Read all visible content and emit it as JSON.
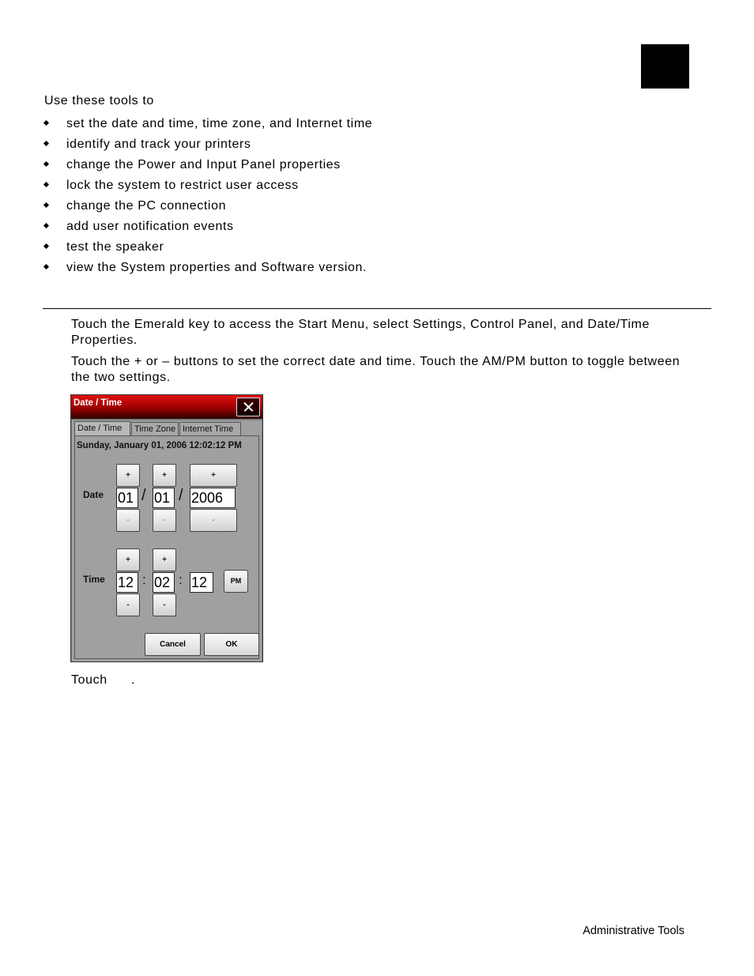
{
  "intro": "Use these tools to",
  "bullets": [
    "set the date and time, time zone, and Internet time",
    "identify and track your printers",
    "change the Power and Input Panel properties",
    "lock the system to restrict user access",
    "change the PC connection",
    "add user notification events",
    "test the speaker",
    "view the System properties and Software version."
  ],
  "steps": [
    "Touch the Emerald key to access the Start Menu, select Settings, Control Panel, and Date/Time Properties.",
    "Touch the + or – buttons to set the correct date and time.  Touch the AM/PM button to toggle between the two settings.",
    "Touch      ."
  ],
  "dialog": {
    "title": "Date / Time",
    "tabs": [
      "Date / Time",
      "Time Zone",
      "Internet Time"
    ],
    "current_datetime": "Sunday, January 01, 2006 12:02:12 PM",
    "date_label": "Date",
    "time_label": "Time",
    "plus": "+",
    "minus": "-",
    "date_sep": "/",
    "time_sep": ":",
    "month": "01",
    "day": "01",
    "year": "2006",
    "hour": "12",
    "minute": "02",
    "second": "12",
    "ampm": "PM",
    "cancel": "Cancel",
    "ok": "OK"
  },
  "footer": "Administrative Tools"
}
